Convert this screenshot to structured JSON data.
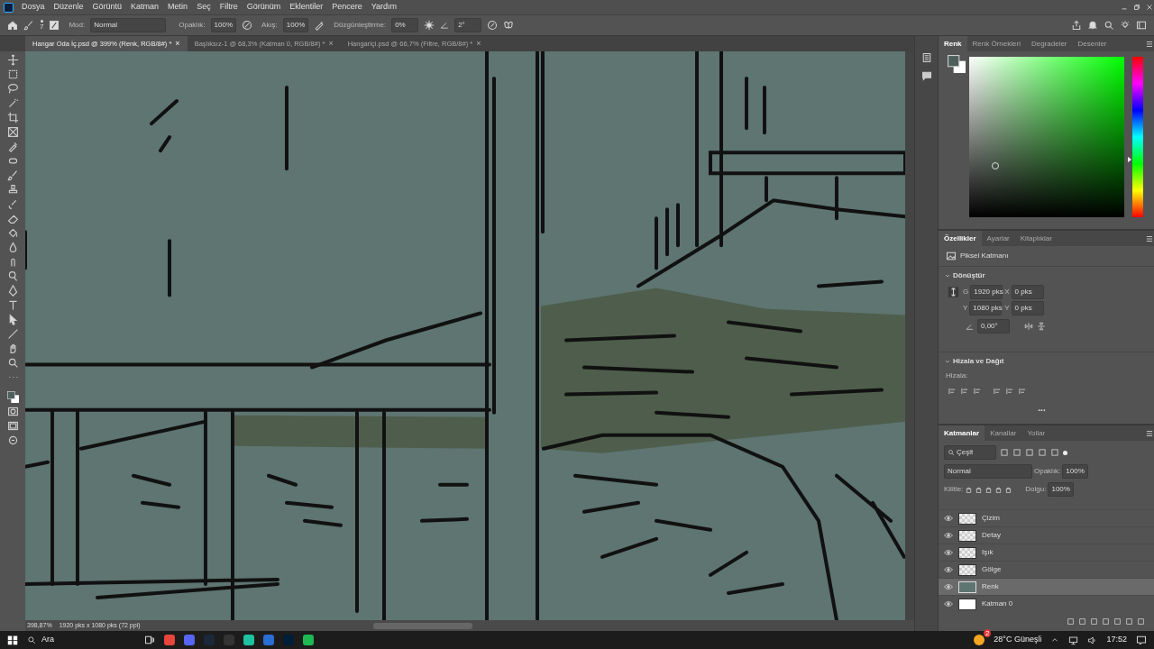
{
  "menu": [
    "Dosya",
    "Düzenle",
    "Görüntü",
    "Katman",
    "Metin",
    "Seç",
    "Filtre",
    "Görünüm",
    "Eklentiler",
    "Pencere",
    "Yardım"
  ],
  "options_bar": {
    "brush_size": "7",
    "mode_label": "Mod:",
    "mode": "Normal",
    "opacity_label": "Opaklık:",
    "opacity": "100%",
    "flow_label": "Akış:",
    "flow": "100%",
    "smoothing_label": "Düzgünleştirme:",
    "smoothing": "0%",
    "angle": "2°"
  },
  "document_tabs": [
    {
      "label": "Hangar Oda İç.psd @ 399% (Renk, RGB/8#) *",
      "close": "×",
      "selected": true
    },
    {
      "label": "Başlıksız-1 @ 68,3% (Katman 0, RGB/8#) *",
      "close": "×",
      "selected": false
    },
    {
      "label": "Hangariçi.psd @ 66,7% (Filtre, RGB/8#) *",
      "close": "×",
      "selected": false
    }
  ],
  "status_bar": {
    "zoom": "398,87%",
    "size": "1920 pks x 1080 pks (72 ppi)"
  },
  "color_panel": {
    "tabs": [
      {
        "label": "Renk",
        "selected": true
      },
      {
        "label": "Renk Örnekleri",
        "selected": false
      },
      {
        "label": "Degradeler",
        "selected": false
      },
      {
        "label": "Desenler",
        "selected": false
      }
    ],
    "swatches": [
      {
        "kind": "foreground",
        "color": "#4d5f5a"
      },
      {
        "kind": "background",
        "color": "#ffffff"
      }
    ],
    "hue": {
      "level": 0.36
    }
  },
  "properties_panel": {
    "tabs": [
      {
        "label": "Özellikler",
        "selected": true
      },
      {
        "label": "Ayarlar",
        "selected": false
      },
      {
        "label": "Kitaplıklar",
        "selected": false
      }
    ],
    "layer_type": "Piksel Katmanı",
    "transform": {
      "title": "Dönüştür",
      "expanded": true,
      "fields": [
        {
          "label": "G",
          "value": "1920 pks"
        },
        {
          "label": "X",
          "value": "0 pks"
        },
        {
          "label": "Y",
          "value": "1080 pks"
        },
        {
          "label": "Y",
          "value": "0 pks"
        }
      ],
      "angle": "0,00°"
    },
    "align": {
      "title": "Hizala ve Dağıt",
      "expanded": true,
      "label": "Hizala:",
      "more": "..."
    }
  },
  "layers_panel": {
    "tabs": [
      {
        "label": "Katmanlar",
        "selected": true
      },
      {
        "label": "Kanallar",
        "selected": false
      },
      {
        "label": "Yollar",
        "selected": false
      }
    ],
    "filter": "Çeşit",
    "blend_mode": "Normal",
    "opacity_label": "Opaklık:",
    "opacity": "100%",
    "lock_label": "Kilitle:",
    "fill_label": "Dolgu:",
    "fill": "100%",
    "layers": [
      {
        "name": "Çizim",
        "visible": true,
        "kind": "transparent",
        "selected": false
      },
      {
        "name": "Detay",
        "visible": true,
        "kind": "transparent",
        "selected": false
      },
      {
        "name": "Işık",
        "visible": true,
        "kind": "transparent",
        "selected": false
      },
      {
        "name": "Gölge",
        "visible": true,
        "kind": "transparent",
        "selected": false
      },
      {
        "name": "Renk",
        "visible": true,
        "kind": "color",
        "selected": true
      },
      {
        "name": "Katman 0",
        "visible": true,
        "kind": "white",
        "selected": false
      }
    ]
  },
  "taskbar": {
    "search": "Ara",
    "weather": "28°C Güneşli",
    "weather_badge": "2",
    "time": "17:52"
  }
}
